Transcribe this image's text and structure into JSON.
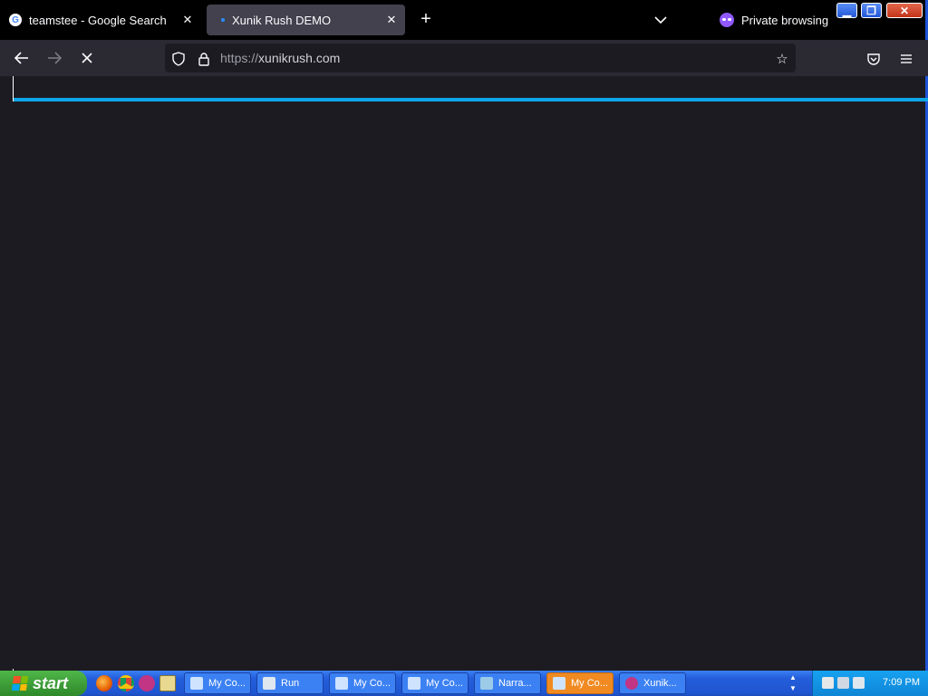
{
  "browser": {
    "tabs": [
      {
        "title": "teamstee - Google Search",
        "favicon": "google-icon",
        "active": false
      },
      {
        "title": "Xunik Rush DEMO",
        "favicon": "loading-dot",
        "active": true
      }
    ],
    "private_label": "Private browsing",
    "url_prefix": "https://",
    "url_host": "xunikrush.com",
    "colors": {
      "progress": "#0ea5e9",
      "page_bg": "#1c1b22",
      "private_accent": "#9059ff"
    }
  },
  "taskbar": {
    "start_label": "start",
    "buttons": [
      {
        "label": "My Co...",
        "icon": "computer-icon",
        "active": false
      },
      {
        "label": "Run",
        "icon": "run-icon",
        "active": false
      },
      {
        "label": "My Co...",
        "icon": "computer-icon",
        "active": false
      },
      {
        "label": "My Co...",
        "icon": "computer-icon",
        "active": false
      },
      {
        "label": "Narra...",
        "icon": "narrator-icon",
        "active": false
      },
      {
        "label": "My Co...",
        "icon": "computer-icon",
        "active": true
      },
      {
        "label": "Xunik...",
        "icon": "firefox-private-icon",
        "active": false
      }
    ],
    "clock": "7:09 PM"
  }
}
